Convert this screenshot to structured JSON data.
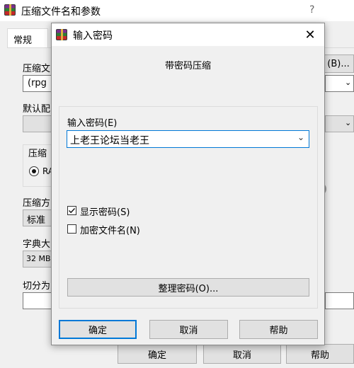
{
  "bg_window": {
    "title": "压缩文件名和参数",
    "help": "?",
    "tab_general": "常规",
    "label_archive_name": "压缩文",
    "archive_value": "(rpg",
    "browse_label": "(B)...",
    "label_default": "默认配",
    "label_format": "压缩",
    "radio_rar": "RA",
    "label_method": "压缩方",
    "method_value": "标准",
    "label_dict": "字典大",
    "dict_value": "32 MB",
    "label_split": "切分为",
    "ok": "确定",
    "cancel": "取消",
    "help_btn": "帮助"
  },
  "dialog": {
    "title": "输入密码",
    "close": "✕",
    "heading": "带密码压缩",
    "password_label": "输入密码(E)",
    "password_value": "上老王论坛当老王",
    "show_password": {
      "label": "显示密码(S)",
      "checked": true
    },
    "encrypt_names": {
      "label": "加密文件名(N)",
      "checked": false
    },
    "organize_button": "整理密码(O)...",
    "ok": "确定",
    "cancel": "取消",
    "help": "帮助"
  }
}
